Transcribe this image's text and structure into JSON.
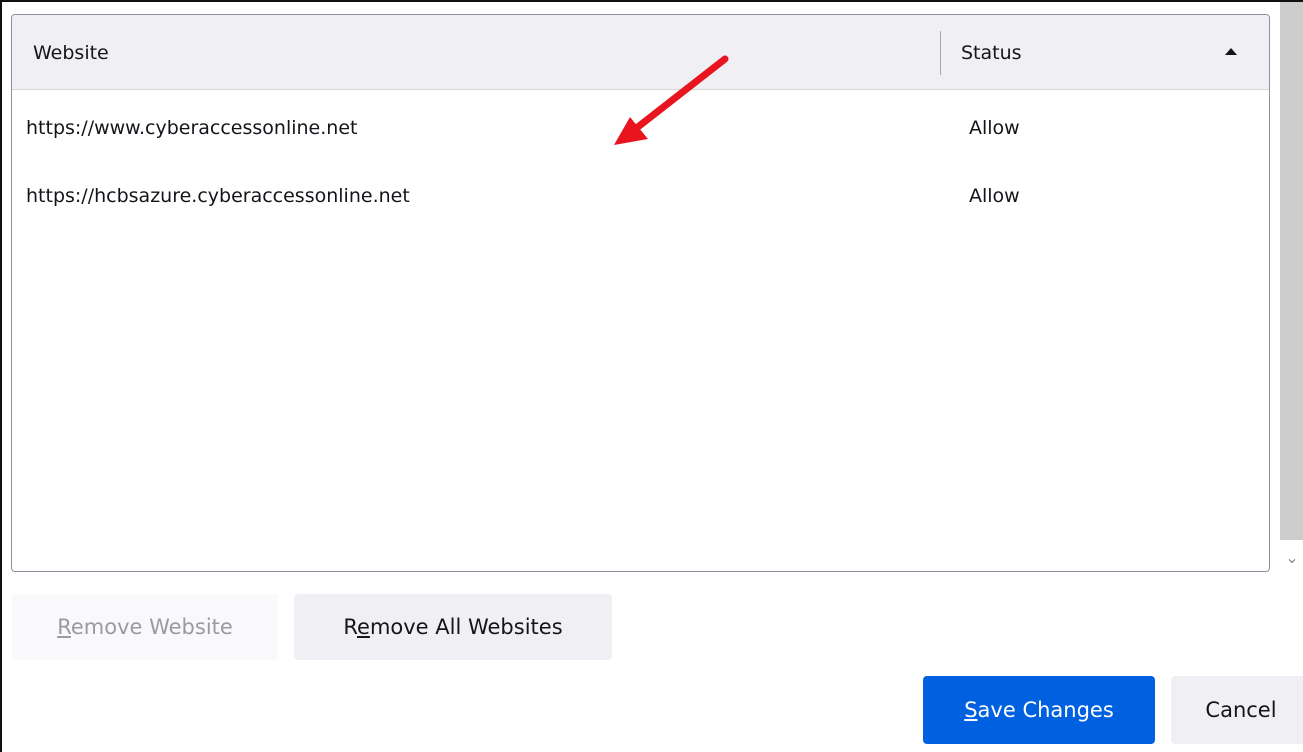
{
  "table": {
    "columns": {
      "website": "Website",
      "status": "Status"
    },
    "rows": [
      {
        "site": "https://www.cyberaccessonline.net",
        "status": "Allow"
      },
      {
        "site": "https://hcbsazure.cyberaccessonline.net",
        "status": "Allow"
      }
    ],
    "sort_indicator": "sort-ascending-icon"
  },
  "buttons": {
    "remove_website": {
      "mnemonic": "R",
      "rest": "emove Website"
    },
    "remove_all": {
      "pre": "R",
      "mnemonic": "e",
      "rest": "move All Websites"
    },
    "save": {
      "mnemonic": "S",
      "rest": "ave Changes"
    },
    "cancel": "Cancel"
  },
  "colors": {
    "primary": "#0061e0",
    "annotation_arrow": "#e8141e"
  }
}
